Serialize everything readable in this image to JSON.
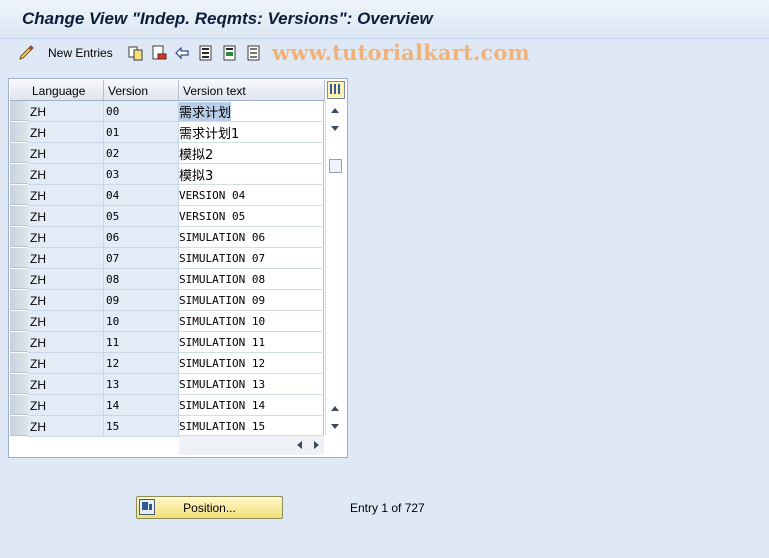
{
  "window": {
    "title": "Change View \"Indep. Reqmts: Versions\": Overview"
  },
  "toolbar": {
    "new_entries_label": "New Entries",
    "icons": [
      "new-entries-icon",
      "copy-icon",
      "delete-icon",
      "undo-icon",
      "select-all-icon",
      "select-block-icon",
      "deselect-all-icon"
    ]
  },
  "watermark": "www.tutorialkart.com",
  "table": {
    "columns": {
      "language": "Language",
      "version": "Version",
      "text": "Version text"
    },
    "rows": [
      {
        "language": "ZH",
        "version": "00",
        "text": "需求计划"
      },
      {
        "language": "ZH",
        "version": "01",
        "text": "需求计划1"
      },
      {
        "language": "ZH",
        "version": "02",
        "text": "模拟2"
      },
      {
        "language": "ZH",
        "version": "03",
        "text": "模拟3"
      },
      {
        "language": "ZH",
        "version": "04",
        "text": "VERSION 04"
      },
      {
        "language": "ZH",
        "version": "05",
        "text": "VERSION 05"
      },
      {
        "language": "ZH",
        "version": "06",
        "text": "SIMULATION 06"
      },
      {
        "language": "ZH",
        "version": "07",
        "text": "SIMULATION 07"
      },
      {
        "language": "ZH",
        "version": "08",
        "text": "SIMULATION 08"
      },
      {
        "language": "ZH",
        "version": "09",
        "text": "SIMULATION 09"
      },
      {
        "language": "ZH",
        "version": "10",
        "text": "SIMULATION 10"
      },
      {
        "language": "ZH",
        "version": "11",
        "text": "SIMULATION 11"
      },
      {
        "language": "ZH",
        "version": "12",
        "text": "SIMULATION 12"
      },
      {
        "language": "ZH",
        "version": "13",
        "text": "SIMULATION 13"
      },
      {
        "language": "ZH",
        "version": "14",
        "text": "SIMULATION 14"
      },
      {
        "language": "ZH",
        "version": "15",
        "text": "SIMULATION 15"
      }
    ]
  },
  "footer": {
    "position_label": "Position...",
    "entry_info": "Entry 1 of 727"
  }
}
